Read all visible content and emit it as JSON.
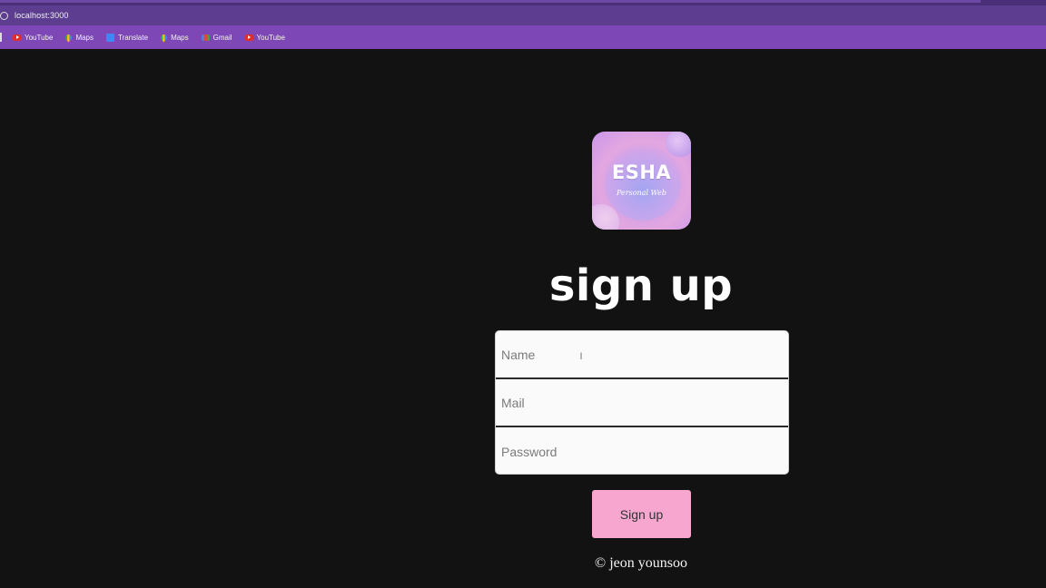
{
  "browser": {
    "url": "localhost:3000",
    "bookmarks": [
      {
        "label": "YouTube",
        "icon": "youtube-icon"
      },
      {
        "label": "Maps",
        "icon": "maps-icon"
      },
      {
        "label": "Translate",
        "icon": "translate-icon"
      },
      {
        "label": "Maps",
        "icon": "maps-icon"
      },
      {
        "label": "Gmail",
        "icon": "gmail-icon"
      },
      {
        "label": "YouTube",
        "icon": "youtube-icon"
      }
    ]
  },
  "logo": {
    "brand": "ESHA",
    "subtitle": "Personal Web"
  },
  "form": {
    "title": "sign up",
    "name_placeholder": "Name",
    "mail_placeholder": "Mail",
    "password_placeholder": "Password",
    "submit_label": "Sign up"
  },
  "footer": {
    "copyright": "© jeon younsoo"
  },
  "colors": {
    "page_background": "#121212",
    "browser_purple": "#7d48b6",
    "button_pink": "#f7a6cf"
  }
}
